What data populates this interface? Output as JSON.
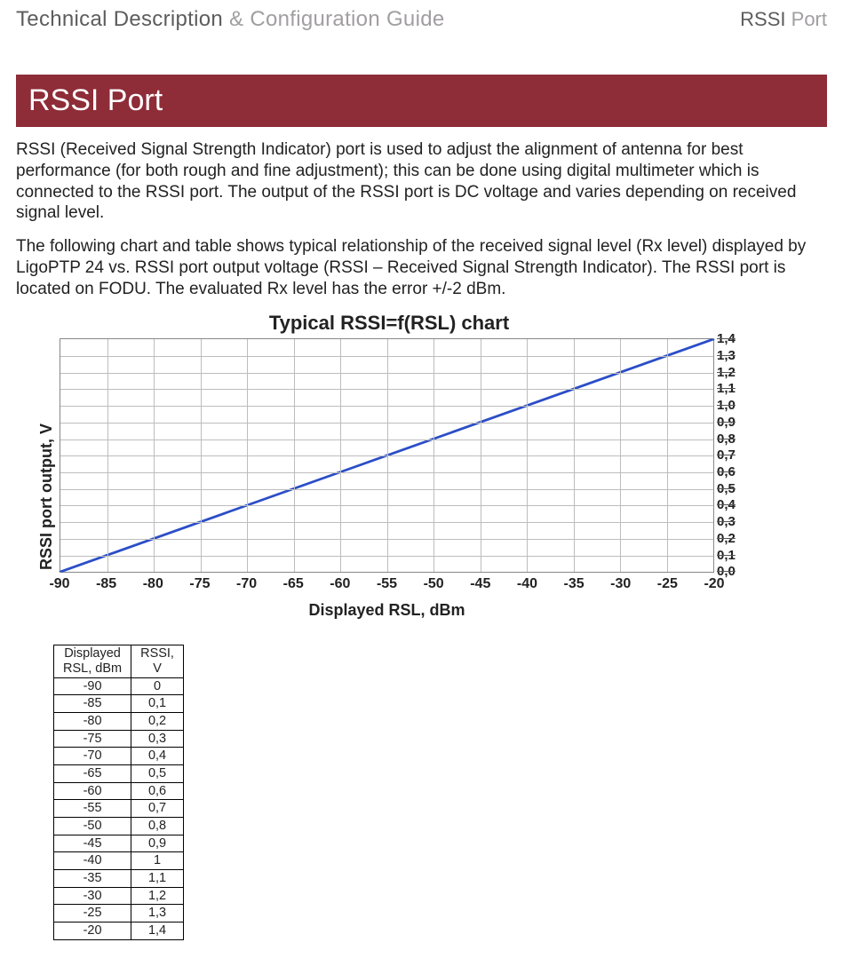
{
  "header": {
    "left_strong": "Technical Description",
    "left_light": " & Configuration Guide",
    "right_strong": "RSSI ",
    "right_light": "Port"
  },
  "section_title": "RSSI Port",
  "para1": "RSSI (Received Signal Strength Indicator) port is used to adjust the alignment of antenna for best performance (for both rough and fine adjustment); this can be done using digital multimeter which is connected to the RSSI port. The output of the RSSI port is DC voltage and varies depending on received signal level.",
  "para2": "The following chart and table shows typical relationship of the received signal level (Rx level) displayed by LigoPTP 24 vs. RSSI port output voltage (RSSI – Received Signal Strength Indicator). The RSSI port is located on FODU. The evaluated Rx level has the error +/-2 dBm.",
  "chart_data": {
    "type": "line",
    "title": "Typical RSSI=f(RSL) chart",
    "xlabel": "Displayed RSL, dBm",
    "ylabel": "RSSI port output, V",
    "x": [
      -90,
      -85,
      -80,
      -75,
      -70,
      -65,
      -60,
      -55,
      -50,
      -45,
      -40,
      -35,
      -30,
      -25,
      -20
    ],
    "y": [
      0,
      0.1,
      0.2,
      0.3,
      0.4,
      0.5,
      0.6,
      0.7,
      0.8,
      0.9,
      1.0,
      1.1,
      1.2,
      1.3,
      1.4
    ],
    "xlim": [
      -90,
      -20
    ],
    "ylim": [
      0,
      1.4
    ],
    "xtick_labels": [
      "-90",
      "-85",
      "-80",
      "-75",
      "-70",
      "-65",
      "-60",
      "-55",
      "-50",
      "-45",
      "-40",
      "-35",
      "-30",
      "-25",
      "-20"
    ],
    "ytick_labels": [
      "0,0",
      "0,1",
      "0,2",
      "0,3",
      "0,4",
      "0,5",
      "0,6",
      "0,7",
      "0,8",
      "0,9",
      "1,0",
      "1,1",
      "1,2",
      "1,3",
      "1,4"
    ]
  },
  "table": {
    "head_col1": "Displayed\nRSL, dBm",
    "head_col2": "RSSI,\nV",
    "rows": [
      {
        "rsl": "-90",
        "rssi": "0"
      },
      {
        "rsl": "-85",
        "rssi": "0,1"
      },
      {
        "rsl": "-80",
        "rssi": "0,2"
      },
      {
        "rsl": "-75",
        "rssi": "0,3"
      },
      {
        "rsl": "-70",
        "rssi": "0,4"
      },
      {
        "rsl": "-65",
        "rssi": "0,5"
      },
      {
        "rsl": "-60",
        "rssi": "0,6"
      },
      {
        "rsl": "-55",
        "rssi": "0,7"
      },
      {
        "rsl": "-50",
        "rssi": "0,8"
      },
      {
        "rsl": "-45",
        "rssi": "0,9"
      },
      {
        "rsl": "-40",
        "rssi": "1"
      },
      {
        "rsl": "-35",
        "rssi": "1,1"
      },
      {
        "rsl": "-30",
        "rssi": "1,2"
      },
      {
        "rsl": "-25",
        "rssi": "1,3"
      },
      {
        "rsl": "-20",
        "rssi": "1,4"
      }
    ]
  }
}
